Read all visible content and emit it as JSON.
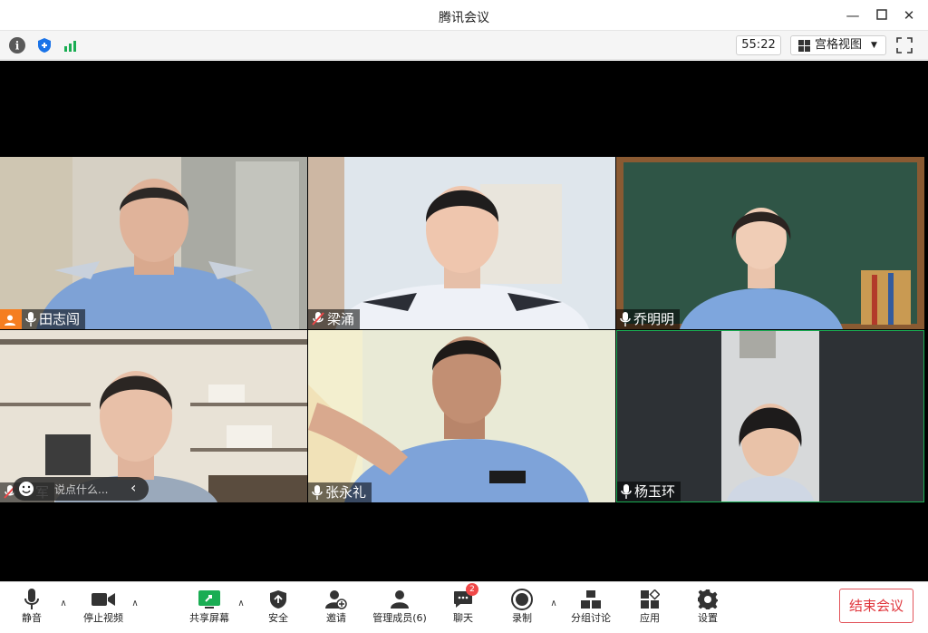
{
  "window": {
    "title": "腾讯会议"
  },
  "statusbar": {
    "timer": "55:22",
    "view_mode": "宫格视图",
    "icons": [
      "info-icon",
      "shield-icon",
      "signal-icon"
    ]
  },
  "participants": [
    {
      "name": "田志闯",
      "mic": "on",
      "host": true
    },
    {
      "name": "梁涌",
      "mic": "muted"
    },
    {
      "name": "乔明明",
      "mic": "on"
    },
    {
      "name": "军",
      "mic": "muted"
    },
    {
      "name": "张永礼",
      "mic": "on"
    },
    {
      "name": "杨玉环",
      "mic": "on",
      "active_speaker": true
    }
  ],
  "chat_bubble": {
    "placeholder": "说点什么..."
  },
  "toolbar": {
    "mute": "静音",
    "stop_video": "停止视频",
    "share_screen": "共享屏幕",
    "security": "安全",
    "invite": "邀请",
    "manage_members": "管理成员(6)",
    "chat": "聊天",
    "chat_badge": "2",
    "record": "录制",
    "breakout": "分组讨论",
    "apps": "应用",
    "settings": "设置",
    "end_meeting": "结束会议"
  },
  "colors": {
    "accent": "#0a6cff",
    "end": "#e0383e",
    "share": "#1aad53"
  }
}
